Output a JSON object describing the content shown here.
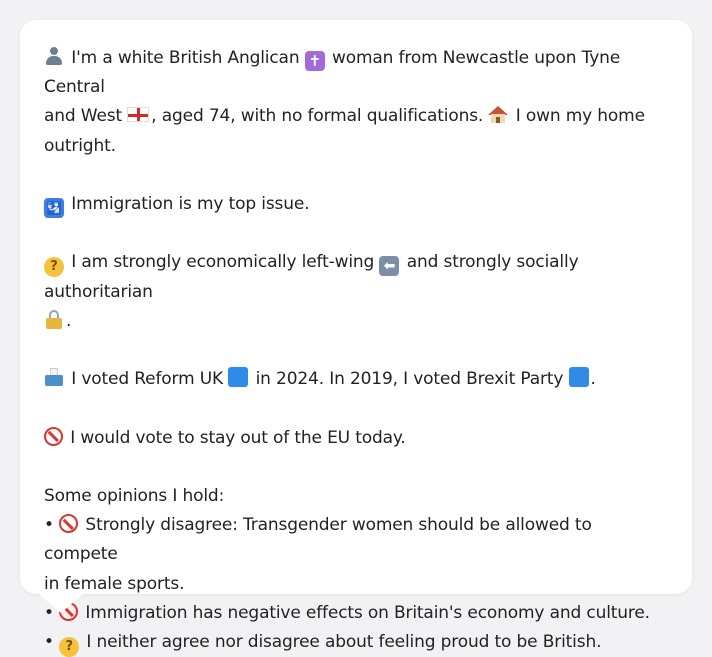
{
  "para1": {
    "line1_a": "I'm a white British Anglican",
    "line1_b": "woman from Newcastle upon Tyne Central",
    "line2_a": "and West",
    "line2_b": ", aged 74, with no formal qualifications.",
    "line2_c": "I own my home",
    "line3": "outright."
  },
  "para2": {
    "text": "Immigration is my top issue."
  },
  "para3": {
    "line1_a": "I am strongly economically left-wing",
    "line1_b": "and strongly socially authoritarian",
    "line2": "."
  },
  "para4": {
    "a": "I voted Reform UK",
    "b": "in 2024. In 2019, I voted Brexit Party",
    "c": "."
  },
  "para5": {
    "text": "I would vote to stay out of the EU today."
  },
  "opinions": {
    "heading": "Some opinions I hold:",
    "item1_line1": "Strongly disagree: Transgender women should be allowed to compete",
    "item1_line2": "in female sports.",
    "item2": "Immigration has negative effects on Britain's economy and culture.",
    "item3": "I neither agree nor disagree about feeling proud to be British.",
    "bullet": "•"
  },
  "icons": {
    "person": "person-icon",
    "cross": "latin-cross-icon",
    "england_flag": "england-flag-icon",
    "house": "house-icon",
    "passport": "passport-control-icon",
    "thinking": "thinking-face-icon",
    "left_arrow": "left-arrow-icon",
    "lock": "lock-icon",
    "ballot": "ballot-box-icon",
    "blue_square": "blue-square-icon",
    "prohibited": "prohibited-icon"
  },
  "colors": {
    "bubble_bg": "#ffffff",
    "page_bg": "#f2f2f4",
    "text": "#222222"
  }
}
